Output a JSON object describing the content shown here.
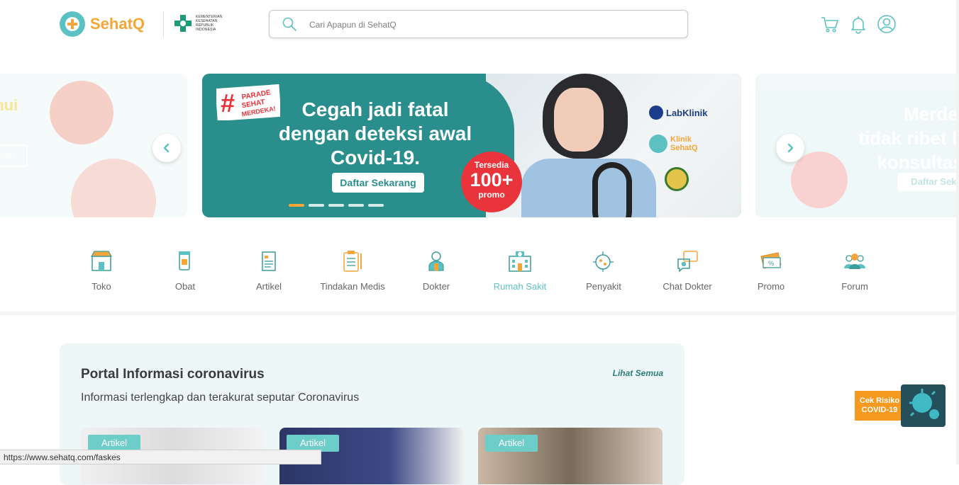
{
  "header": {
    "brand": "SehatQ",
    "partner_logo_text": "KEMENTERIAN KESEHATAN REPUBLIK INDONESIA",
    "search_placeholder": "Cari Apapun di SehatQ",
    "icons": [
      "cart-icon",
      "bell-icon",
      "user-icon"
    ]
  },
  "banner": {
    "main": {
      "hashtag": "#PARADE SEHAT MERDEKA!",
      "title_line1": "Cegah jadi fatal",
      "title_line2": "dengan deteksi awal",
      "title_line3": "Covid-19.",
      "cta": "Daftar Sekarang",
      "promo_top": "Tersedia",
      "promo_big": "100+",
      "promo_bottom": "promo",
      "partners": [
        "LabKlinik",
        "Klinik SehatQ"
      ]
    },
    "left": {
      "text_line1": "ahui",
      "cta": "gahan"
    },
    "right": {
      "text_line1": "Merdek",
      "text_line2": "tidak ribet bi",
      "text_line3": "konsultasi",
      "cta": "Daftar Seka"
    },
    "active_slide": 0,
    "slide_count": 5
  },
  "categories": [
    {
      "label": "Toko",
      "icon": "store-icon"
    },
    {
      "label": "Obat",
      "icon": "medicine-icon"
    },
    {
      "label": "Artikel",
      "icon": "article-icon"
    },
    {
      "label": "Tindakan Medis",
      "icon": "clipboard-icon"
    },
    {
      "label": "Dokter",
      "icon": "doctor-icon"
    },
    {
      "label": "Rumah Sakit",
      "icon": "hospital-icon"
    },
    {
      "label": "Penyakit",
      "icon": "virus-icon"
    },
    {
      "label": "Chat Dokter",
      "icon": "chat-icon"
    },
    {
      "label": "Promo",
      "icon": "coupon-icon"
    },
    {
      "label": "Forum",
      "icon": "forum-icon"
    }
  ],
  "active_category": "Rumah Sakit",
  "portal": {
    "title": "Portal Informasi coronavirus",
    "subtitle": "Informasi terlengkap dan terakurat seputar Coronavirus",
    "link": "Lihat Semua",
    "cards": [
      {
        "badge": "Artikel"
      },
      {
        "badge": "Artikel"
      },
      {
        "badge": "Artikel"
      }
    ]
  },
  "floating": {
    "label_line1": "Cek Risiko",
    "label_line2": "COVID-19"
  },
  "statusbar": {
    "url": "https://www.sehatq.com/faskes"
  },
  "colors": {
    "teal": "#5cc1c3",
    "orange": "#f4a63a",
    "banner_teal": "#2a8f8c",
    "promo_red": "#e8343a"
  }
}
